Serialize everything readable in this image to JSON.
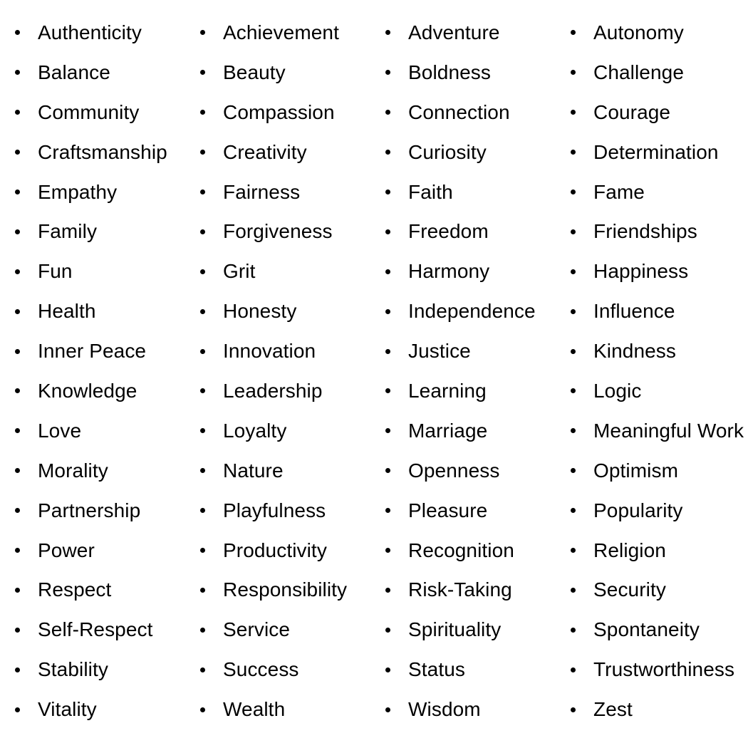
{
  "page": {
    "kind": "bulleted-values-list",
    "background_color": "#ffffff",
    "text_color": "#000000",
    "bullet_color": "#000000",
    "bullet_glyph": "•",
    "columns": 4,
    "rows": 18,
    "total_items": 72
  },
  "values_list": {
    "items": [
      "Authenticity",
      "Achievement",
      "Adventure",
      "Autonomy",
      "Balance",
      "Beauty",
      "Boldness",
      "Challenge",
      "Community",
      "Compassion",
      "Connection",
      "Courage",
      "Craftsmanship",
      "Creativity",
      "Curiosity",
      "Determination",
      "Empathy",
      "Fairness",
      "Faith",
      "Fame",
      "Family",
      "Forgiveness",
      "Freedom",
      "Friendships",
      "Fun",
      "Grit",
      "Harmony",
      "Happiness",
      "Health",
      "Honesty",
      "Independence",
      "Influence",
      "Inner Peace",
      "Innovation",
      "Justice",
      "Kindness",
      "Knowledge",
      "Leadership",
      "Learning",
      "Logic",
      "Love",
      "Loyalty",
      "Marriage",
      "Meaningful Work",
      "Morality",
      "Nature",
      "Openness",
      "Optimism",
      "Partnership",
      "Playfulness",
      "Pleasure",
      "Popularity",
      "Power",
      "Productivity",
      "Recognition",
      "Religion",
      "Respect",
      "Responsibility",
      "Risk-Taking",
      "Security",
      "Self-Respect",
      "Service",
      "Spirituality",
      "Spontaneity",
      "Stability",
      "Success",
      "Status",
      "Trustworthiness",
      "Vitality",
      "Wealth",
      "Wisdom",
      "Zest"
    ]
  }
}
